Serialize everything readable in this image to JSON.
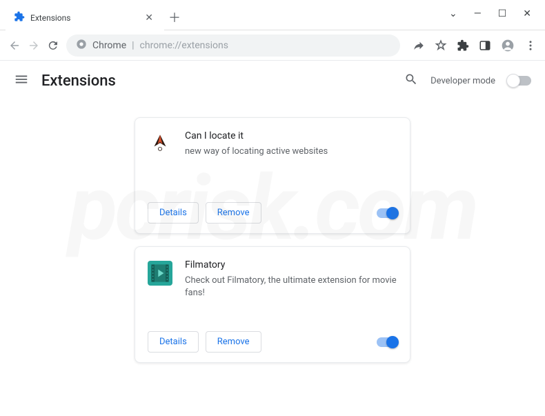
{
  "tab": {
    "title": "Extensions"
  },
  "omnibox": {
    "scheme_label": "Chrome",
    "url": "chrome://extensions"
  },
  "header": {
    "title": "Extensions",
    "dev_mode_label": "Developer mode",
    "dev_mode_on": false
  },
  "buttons": {
    "details": "Details",
    "remove": "Remove"
  },
  "extensions": [
    {
      "name": "Can I locate it",
      "description": "new way of locating active websites",
      "enabled": true
    },
    {
      "name": "Filmatory",
      "description": "Check out Filmatory, the ultimate extension for movie fans!",
      "enabled": true
    }
  ],
  "watermark": "pcrisk.com"
}
